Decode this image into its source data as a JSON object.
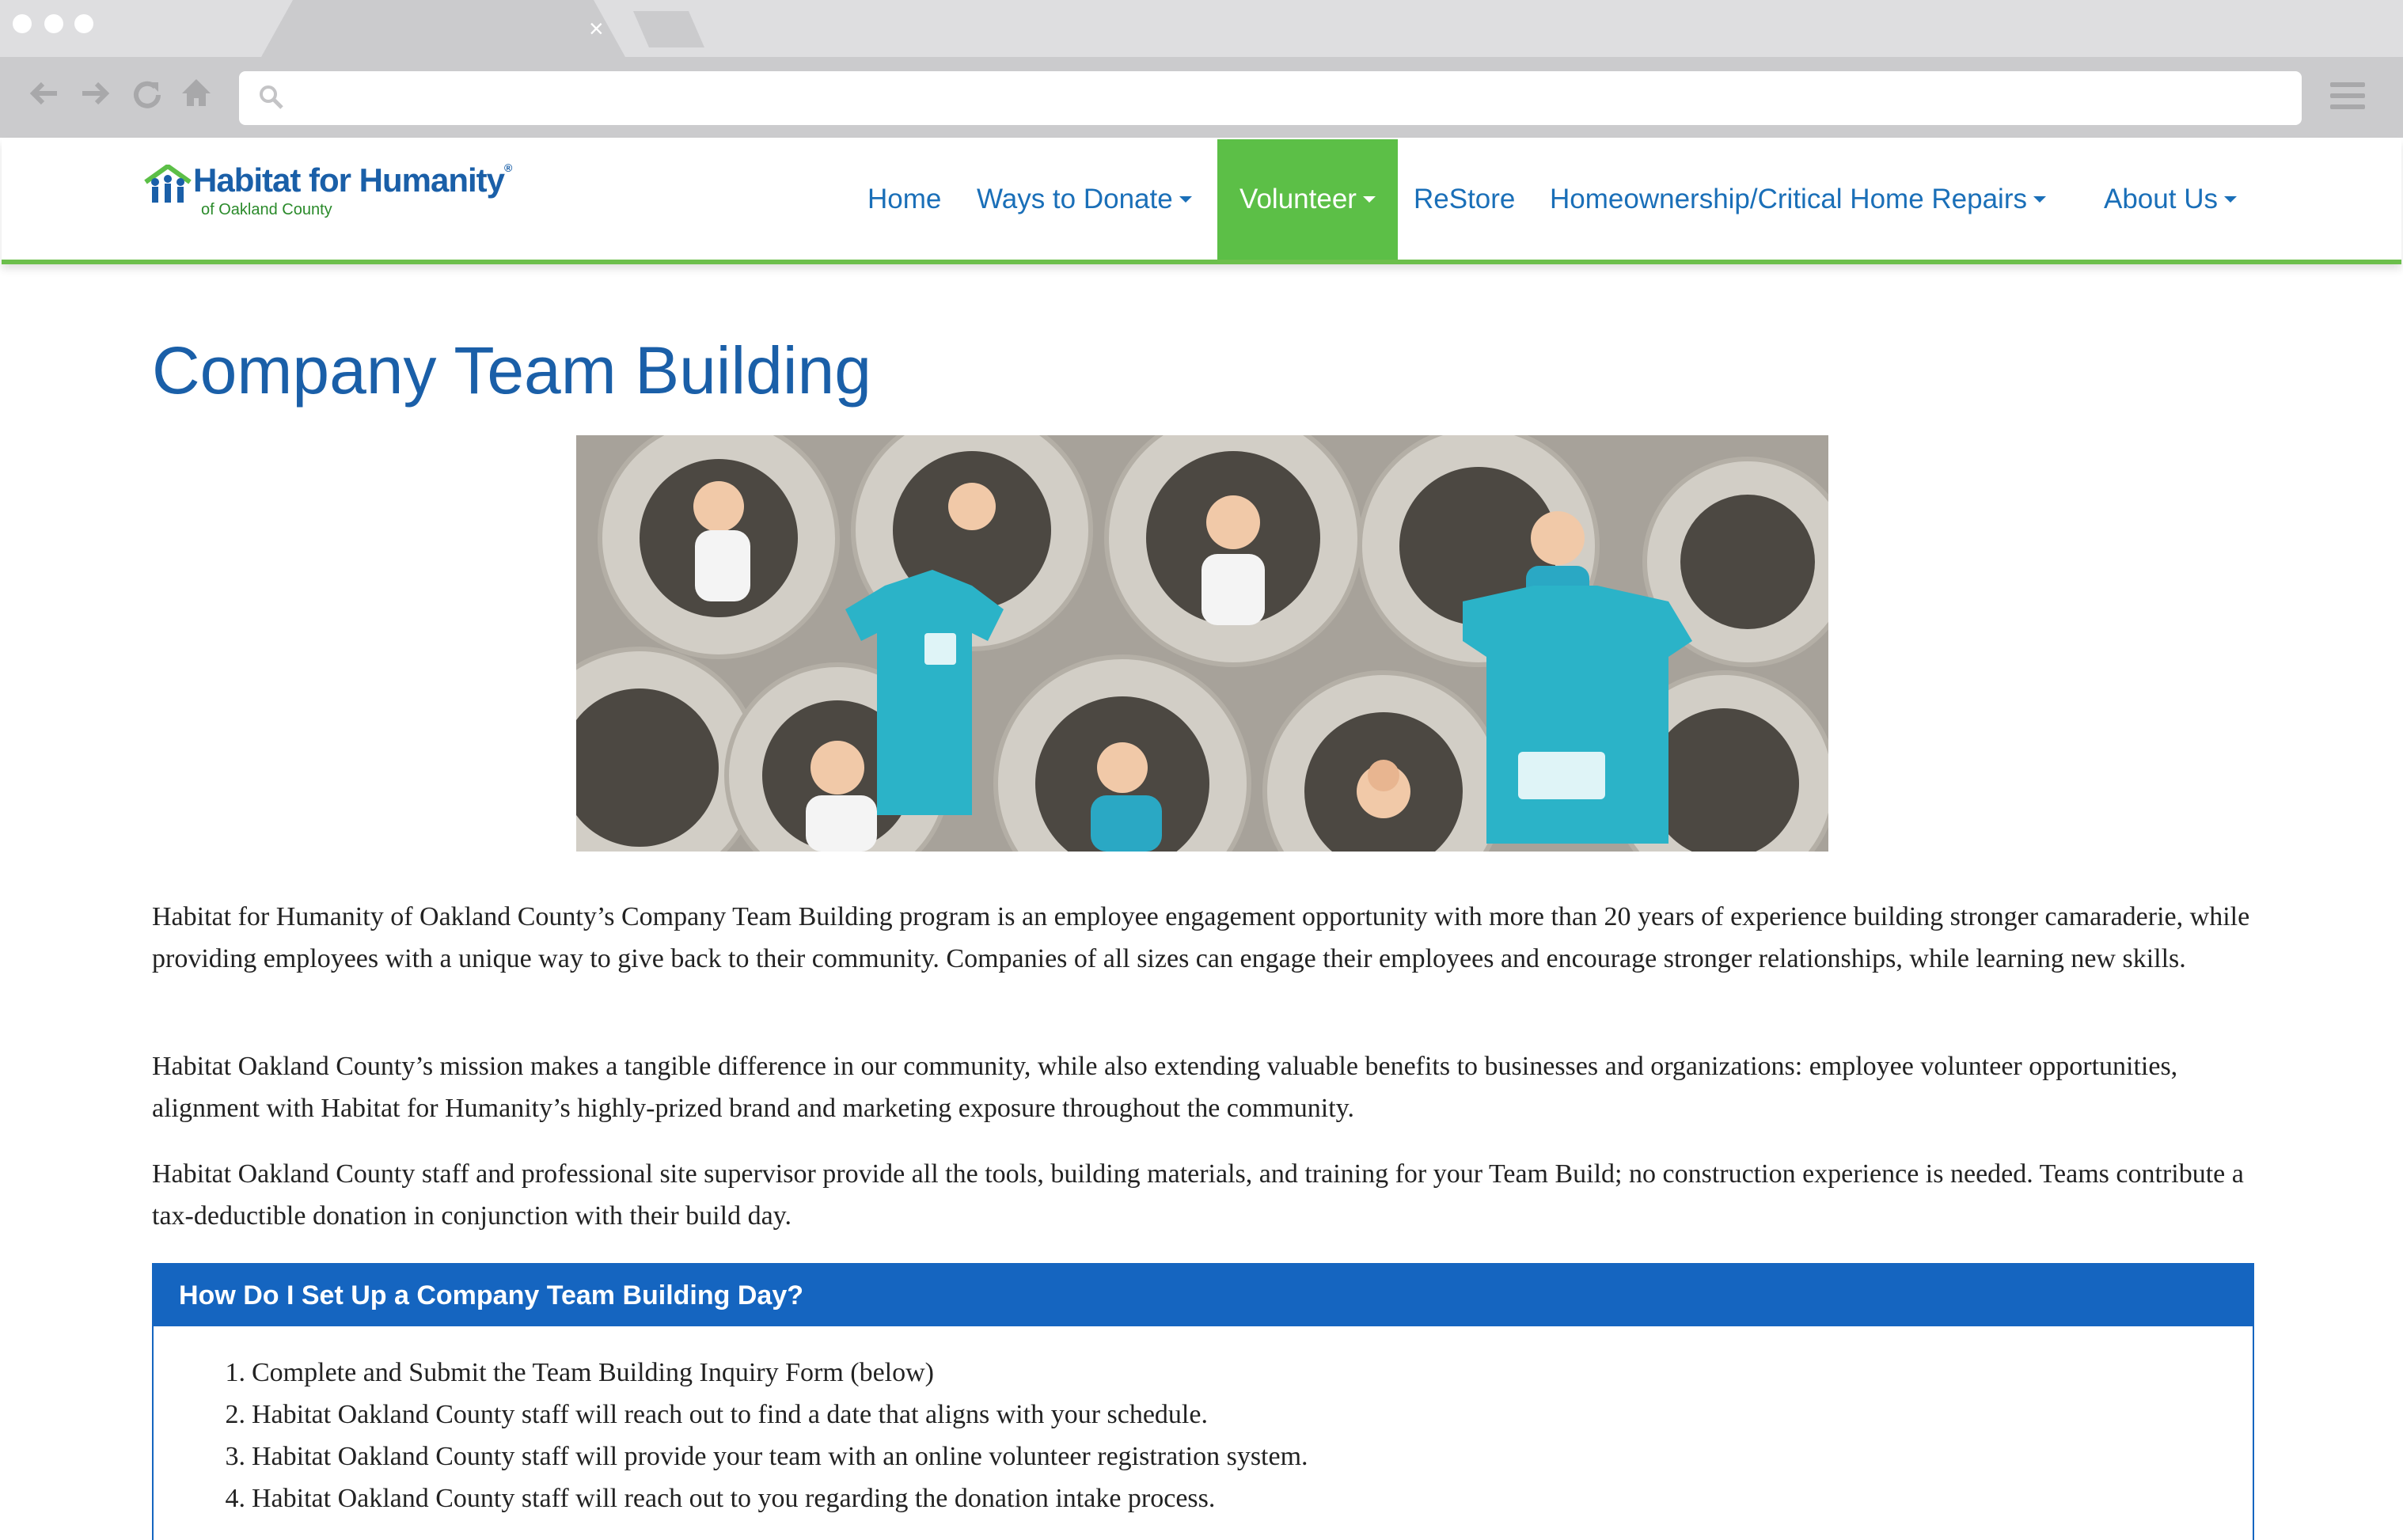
{
  "browser": {
    "tab_close_glyph": "×",
    "icons": [
      "back-arrow-icon",
      "forward-arrow-icon",
      "reload-icon",
      "home-icon",
      "search-icon",
      "menu-icon"
    ]
  },
  "site": {
    "logo": {
      "title": "Habitat for Humanity",
      "registered": "®",
      "subtitle": "of Oakland County"
    },
    "nav": [
      {
        "label": "Home",
        "dropdown": false
      },
      {
        "label": "Ways to Donate",
        "dropdown": true
      },
      {
        "label": "Volunteer",
        "dropdown": true,
        "active": true
      },
      {
        "label": "ReStore",
        "dropdown": false
      },
      {
        "label": "Homeownership/Critical Home Repairs",
        "dropdown": true
      },
      {
        "label": "About Us",
        "dropdown": true
      }
    ],
    "colors": {
      "brand_blue": "#1a5fa8",
      "nav_text": "#1a6fb8",
      "active_green": "#5cbf47",
      "panel_blue": "#1565c0"
    }
  },
  "content": {
    "title": "Company Team Building",
    "paragraphs": [
      "Habitat for Humanity of Oakland County’s Company Team Building program is an employee engagement opportunity with more than 20 years of experience building stronger camaraderie, while providing employees with a unique way to give back to their community. Companies of all sizes can engage their employees and encourage stronger relationships, while learning new skills.",
      "Habitat Oakland County’s mission makes a tangible difference in our community, while also extending valuable benefits to businesses and organizations: employee volunteer opportunities, alignment with Habitat for Humanity’s highly-prized brand and marketing exposure throughout the community.",
      "Habitat Oakland County staff and professional site supervisor provide all the tools, building materials, and training for your Team Build; no construction experience is needed. Teams contribute a tax-deductible donation in conjunction with their build day."
    ],
    "panel": {
      "heading": "How Do I Set Up a Company Team Building Day?",
      "steps": [
        {
          "num": "1.",
          "text": "Complete and Submit the Team Building Inquiry Form (below)"
        },
        {
          "num": "2.",
          "text": "Habitat Oakland County staff will reach out to find a date that aligns with your schedule."
        },
        {
          "num": "3.",
          "text": "Habitat Oakland County staff will provide your team with an online volunteer registration system."
        },
        {
          "num": "4.",
          "text": "Habitat Oakland County staff will reach out to you regarding the donation intake process."
        }
      ]
    }
  }
}
